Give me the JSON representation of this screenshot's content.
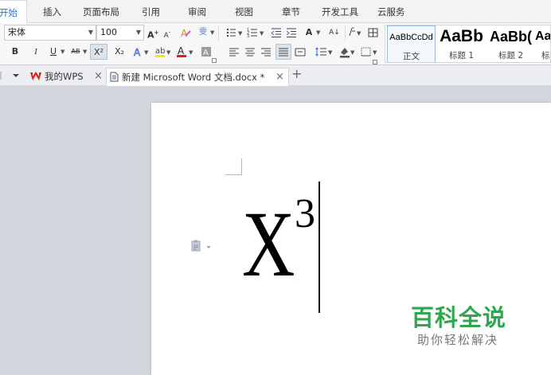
{
  "menu": {
    "tabs": [
      {
        "label": "开始",
        "active": true
      },
      {
        "label": "插入"
      },
      {
        "label": "页面布局"
      },
      {
        "label": "引用"
      },
      {
        "label": "审阅"
      },
      {
        "label": "视图"
      },
      {
        "label": "章节"
      },
      {
        "label": "开发工具"
      },
      {
        "label": "云服务"
      }
    ]
  },
  "ribbon": {
    "font_name": "宋体",
    "font_size": "100",
    "bold": "B",
    "italic": "I",
    "underline": "U",
    "strike": "AB",
    "superscript": "X²",
    "subscript": "X₂",
    "grow_font": "A",
    "shrink_font": "A",
    "pinyin": "雯",
    "char_scale": "A",
    "sort": "A↓",
    "styles": [
      {
        "preview": "AaBbCcDd",
        "name": "正文"
      },
      {
        "preview": "AaBb",
        "name": "标题 1"
      },
      {
        "preview": "AaBb(",
        "name": "标题 2"
      },
      {
        "preview": "Aa",
        "name": "标"
      }
    ]
  },
  "tabbar": {
    "wps_tab": "我的WPS",
    "doc_tab": "新建 Microsoft Word 文档.docx *",
    "close": "×",
    "new_tab": "+"
  },
  "document": {
    "base_char": "X",
    "superscript_char": "3"
  },
  "watermark": {
    "title": "百科全说",
    "subtitle": "助你轻松解决"
  },
  "colors": {
    "accent_blue": "#2b73c8",
    "watermark_green": "#2ea84f",
    "wps_red": "#d9261c",
    "highlight_yellow": "#ffe600",
    "font_color_red": "#e02020"
  }
}
